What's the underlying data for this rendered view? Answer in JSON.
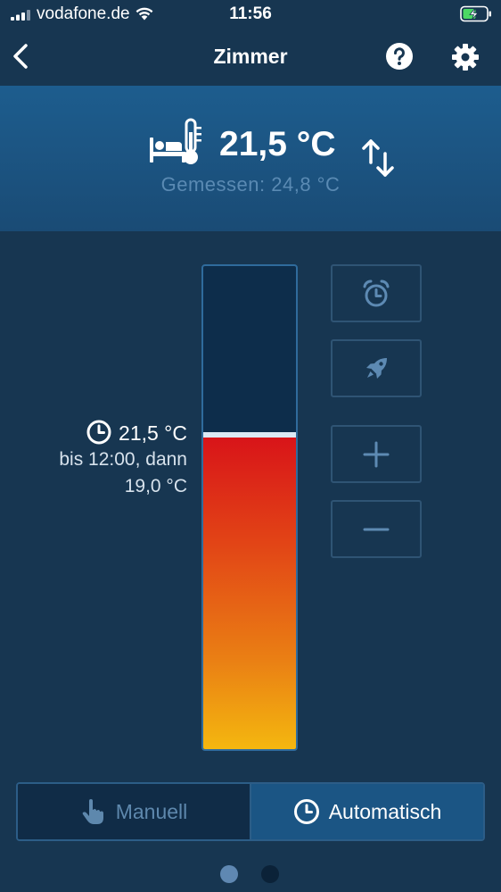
{
  "status_bar": {
    "carrier": "vodafone.de",
    "time": "11:56",
    "icons": [
      "signal-icon",
      "wifi-icon",
      "battery-charging-icon"
    ]
  },
  "nav": {
    "title": "Zimmer",
    "back_icon": "chevron-left-icon",
    "help_icon": "help-icon",
    "settings_icon": "gear-icon"
  },
  "header": {
    "room_icon": "bed-thermometer-icon",
    "target_temp": "21,5 °C",
    "trend_icon": "up-down-arrows-icon",
    "measured": "Gemessen: 24,8 °C"
  },
  "schedule": {
    "icon": "clock-icon",
    "current_temp": "21,5 °C",
    "until_text": "bis 12:00, dann",
    "next_temp": "19,0 °C"
  },
  "slider": {
    "level": 0.65
  },
  "buttons": {
    "alarm_icon": "alarm-clock-icon",
    "boost_icon": "rocket-icon",
    "plus_icon": "plus-icon",
    "minus_icon": "minus-icon"
  },
  "mode": {
    "manual_label": "Manuell",
    "auto_label": "Automatisch",
    "selected": "Automatisch",
    "manual_icon": "hand-pointer-icon",
    "auto_icon": "clock-icon"
  },
  "pager": {
    "pages": 2,
    "current": 1
  },
  "colors": {
    "background": "#173651",
    "header": "#1d5d8e",
    "accent": "#1b5584",
    "slider_hot": "#d81319",
    "slider_warm": "#f4b70f"
  }
}
